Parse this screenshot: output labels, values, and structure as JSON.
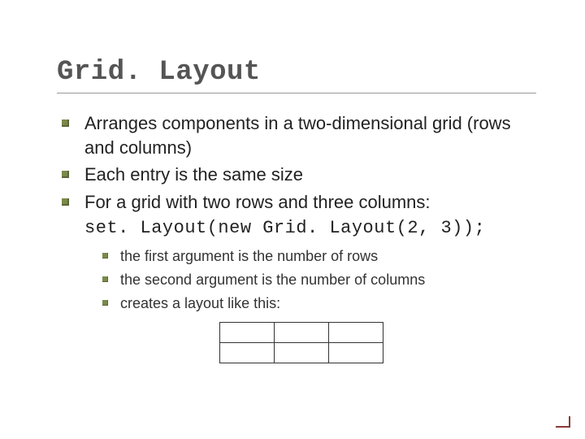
{
  "title": "Grid. Layout",
  "bullets": [
    "Arranges components in a two-dimensional grid (rows and columns)",
    "Each entry is the same size",
    "For a grid with two rows and three columns:"
  ],
  "code_line": "set. Layout(new Grid. Layout(2, 3));",
  "sub_bullets": [
    "the first argument is the number of rows",
    "the second argument is the number of columns",
    "creates a layout like this:"
  ],
  "grid": {
    "rows": 2,
    "cols": 3
  }
}
